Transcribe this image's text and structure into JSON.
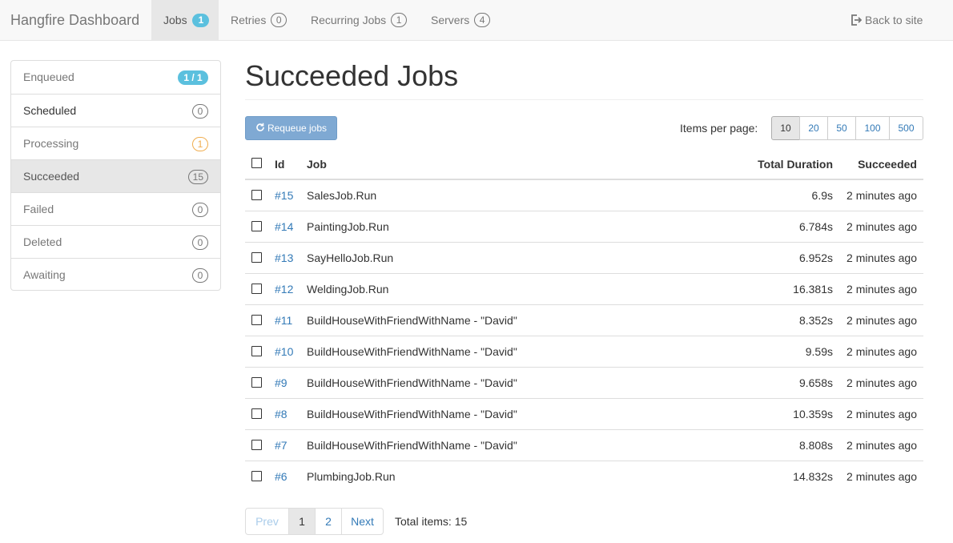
{
  "navbar": {
    "brand": "Hangfire Dashboard",
    "items": [
      {
        "label": "Jobs",
        "badge": "1"
      },
      {
        "label": "Retries",
        "badge": "0"
      },
      {
        "label": "Recurring Jobs",
        "badge": "1"
      },
      {
        "label": "Servers",
        "badge": "4"
      }
    ],
    "back_label": "Back to site",
    "back_icon": "log-out-icon"
  },
  "sidebar": {
    "items": [
      {
        "label": "Enqueued",
        "badge": "1 / 1"
      },
      {
        "label": "Scheduled",
        "badge": "0"
      },
      {
        "label": "Processing",
        "badge": "1"
      },
      {
        "label": "Succeeded",
        "badge": "15"
      },
      {
        "label": "Failed",
        "badge": "0"
      },
      {
        "label": "Deleted",
        "badge": "0"
      },
      {
        "label": "Awaiting",
        "badge": "0"
      }
    ]
  },
  "main": {
    "title": "Succeeded Jobs",
    "requeue_label": "Requeue jobs",
    "items_per_page_label": "Items per page:",
    "items_per_page_options": [
      "10",
      "20",
      "50",
      "100",
      "500"
    ],
    "items_per_page_selected": "10",
    "table": {
      "columns": [
        "Id",
        "Job",
        "Total Duration",
        "Succeeded"
      ],
      "rows": [
        {
          "id": "#15",
          "job": "SalesJob.Run",
          "duration": "6.9s",
          "succeeded": "2 minutes ago"
        },
        {
          "id": "#14",
          "job": "PaintingJob.Run",
          "duration": "6.784s",
          "succeeded": "2 minutes ago"
        },
        {
          "id": "#13",
          "job": "SayHelloJob.Run",
          "duration": "6.952s",
          "succeeded": "2 minutes ago"
        },
        {
          "id": "#12",
          "job": "WeldingJob.Run",
          "duration": "16.381s",
          "succeeded": "2 minutes ago"
        },
        {
          "id": "#11",
          "job": "BuildHouseWithFriendWithName - \"David\"",
          "duration": "8.352s",
          "succeeded": "2 minutes ago"
        },
        {
          "id": "#10",
          "job": "BuildHouseWithFriendWithName - \"David\"",
          "duration": "9.59s",
          "succeeded": "2 minutes ago"
        },
        {
          "id": "#9",
          "job": "BuildHouseWithFriendWithName - \"David\"",
          "duration": "9.658s",
          "succeeded": "2 minutes ago"
        },
        {
          "id": "#8",
          "job": "BuildHouseWithFriendWithName - \"David\"",
          "duration": "10.359s",
          "succeeded": "2 minutes ago"
        },
        {
          "id": "#7",
          "job": "BuildHouseWithFriendWithName - \"David\"",
          "duration": "8.808s",
          "succeeded": "2 minutes ago"
        },
        {
          "id": "#6",
          "job": "PlumbingJob.Run",
          "duration": "14.832s",
          "succeeded": "2 minutes ago"
        }
      ]
    },
    "pagination": {
      "prev_label": "Prev",
      "pages": [
        "1",
        "2"
      ],
      "current": "1",
      "next_label": "Next",
      "total_items": "Total items: 15"
    }
  },
  "colors": {
    "link": "#337ab7",
    "info_badge": "#5bc0de",
    "warning_badge": "#f0ad4e",
    "requeue_button": "#7fa9d3"
  }
}
